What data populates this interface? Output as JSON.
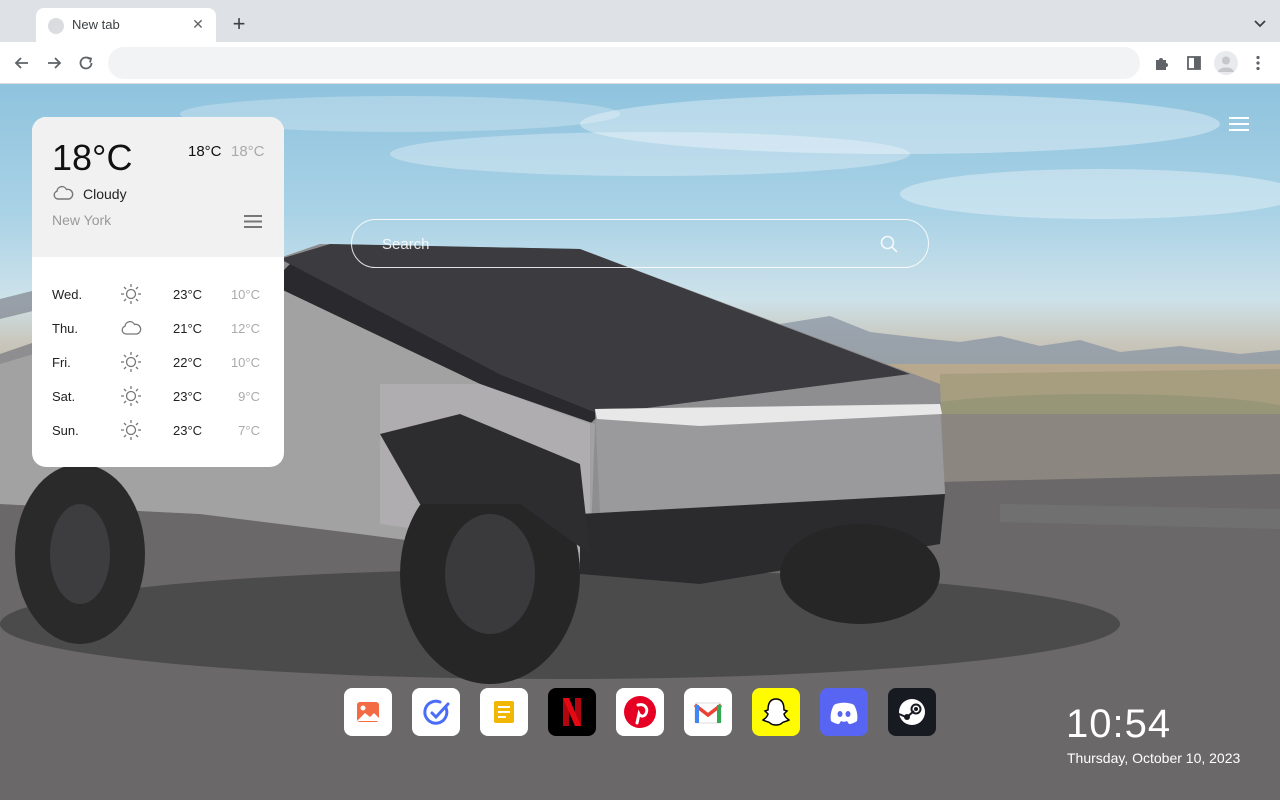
{
  "browser": {
    "tab_title": "New tab",
    "omnibox_value": ""
  },
  "weather": {
    "current_temp": "18°C",
    "high": "18°C",
    "low": "18°C",
    "condition": "Cloudy",
    "condition_icon": "cloud-icon",
    "city": "New York",
    "forecast": [
      {
        "day": "Wed.",
        "icon": "sun-icon",
        "high": "23°C",
        "low": "10°C"
      },
      {
        "day": "Thu.",
        "icon": "cloud-icon",
        "high": "21°C",
        "low": "12°C"
      },
      {
        "day": "Fri.",
        "icon": "sun-icon",
        "high": "22°C",
        "low": "10°C"
      },
      {
        "day": "Sat.",
        "icon": "sun-icon",
        "high": "23°C",
        "low": "9°C"
      },
      {
        "day": "Sun.",
        "icon": "sun-icon",
        "high": "23°C",
        "low": "7°C"
      }
    ]
  },
  "search": {
    "placeholder": "Search"
  },
  "dock": [
    {
      "name": "photos-shortcut",
      "icon": "image-icon",
      "color": "#f26b43"
    },
    {
      "name": "tasks-shortcut",
      "icon": "check-circle-icon",
      "color": "#4a6cf7"
    },
    {
      "name": "notes-shortcut",
      "icon": "note-icon",
      "color": "#f2b705"
    },
    {
      "name": "netflix-shortcut",
      "icon": "netflix-icon",
      "color": "#e50914"
    },
    {
      "name": "pinterest-shortcut",
      "icon": "pinterest-icon",
      "color": "#e60023"
    },
    {
      "name": "gmail-shortcut",
      "icon": "gmail-icon",
      "color": "#ea4335"
    },
    {
      "name": "snapchat-shortcut",
      "icon": "snapchat-icon",
      "color": "#fffc00"
    },
    {
      "name": "discord-shortcut",
      "icon": "discord-icon",
      "color": "#5865f2"
    },
    {
      "name": "steam-shortcut",
      "icon": "steam-icon",
      "color": "#171a21"
    }
  ],
  "clock": {
    "time": "10:54",
    "date": "Thursday, October 10, 2023"
  }
}
